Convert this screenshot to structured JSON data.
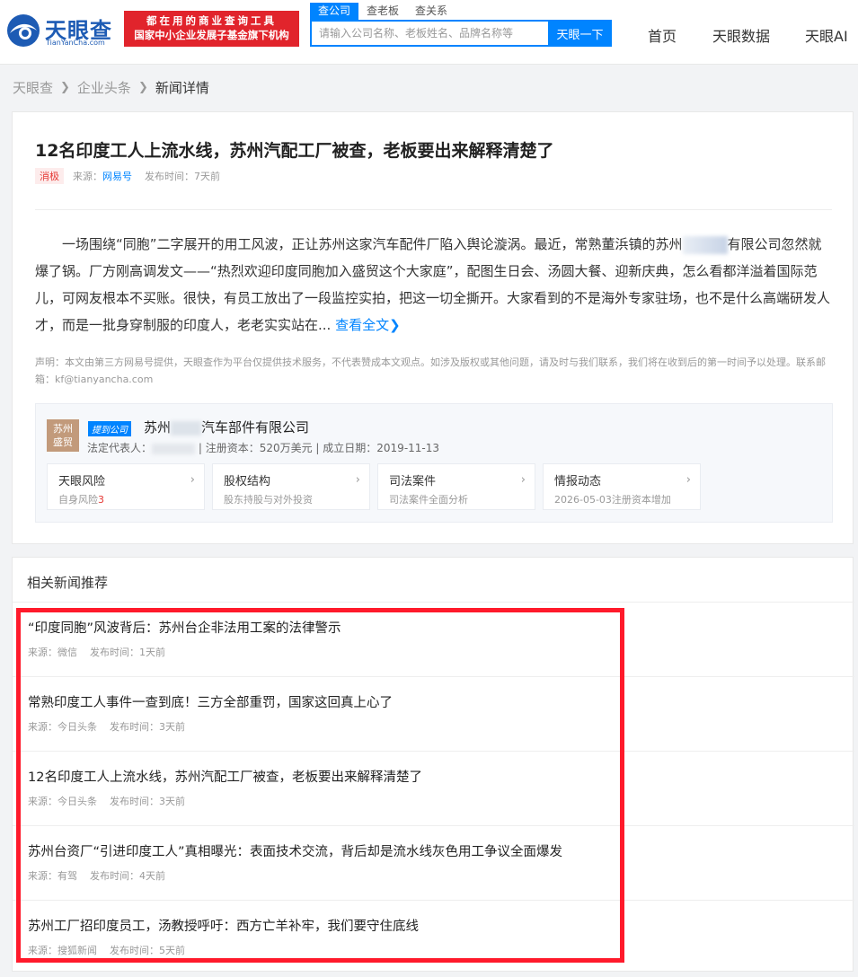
{
  "header": {
    "logo_text": "天眼查",
    "logo_sub": "TianYanCha.com",
    "slogan_line1": "都在用的商业查询工具",
    "slogan_line2": "国家中小企业发展子基金旗下机构",
    "search_tabs": [
      "查公司",
      "查老板",
      "查关系"
    ],
    "search_placeholder": "请输入公司名称、老板姓名、品牌名称等",
    "search_button": "天眼一下",
    "nav": [
      "首页",
      "天眼数据",
      "天眼AI"
    ]
  },
  "breadcrumb": [
    "天眼查",
    "企业头条",
    "新闻详情"
  ],
  "article": {
    "title": "12名印度工人上流水线，苏州汽配工厂被查，老板要出来解释清楚了",
    "tag": "消极",
    "source_label": "来源：",
    "source": "网易号",
    "time": "发布时间：7天前",
    "body_part1": "一场围绕“同胞”二字展开的用工风波，正让苏州这家汽车配件厂陷入舆论漩涡。最近，常熟董浜镇的苏州",
    "body_part2": "有限公司忽然就爆了锅。厂方刚高调发文——“热烈欢迎印度同胞加入盛贸这个大家庭”，配图生日会、汤圆大餐、迎新庆典，怎么看都洋溢着国际范儿，可网友根本不买账。很快，有员工放出了一段监控实拍，把这一切全撕开。大家看到的不是海外专家驻场，也不是什么高端研发人才，而是一批身穿制服的印度人，老老实实站在...",
    "read_more": "查看全文",
    "disclaimer": "声明：本文由第三方网易号提供，天眼查作为平台仅提供技术服务，不代表赞成本文观点。如涉及版权或其他问题，请及时与我们联系，我们将在收到后的第一时间予以处理。联系邮箱：kf@tianyancha.com"
  },
  "company": {
    "logo_text": "苏州盛贸",
    "badge": "提到公司",
    "name_prefix": "苏州",
    "name_suffix": "汽车部件有限公司",
    "legal_rep_label": "法定代表人：",
    "info_rest": "| 注册资本：520万美元 | 成立日期：2019-11-13",
    "cards": [
      {
        "title": "天眼风险",
        "sub": "自身风险",
        "num": "3"
      },
      {
        "title": "股权结构",
        "sub": "股东持股与对外投资",
        "num": ""
      },
      {
        "title": "司法案件",
        "sub": "司法案件全面分析",
        "num": ""
      },
      {
        "title": "情报动态",
        "sub": "2026-05-03注册资本增加",
        "num": ""
      }
    ]
  },
  "related": {
    "title": "相关新闻推荐",
    "items": [
      {
        "title": "“印度同胞”风波背后：苏州台企非法用工案的法律警示",
        "source": "来源：微信",
        "time": "发布时间：1天前"
      },
      {
        "title": "常熟印度工人事件一查到底！三方全部重罚，国家这回真上心了",
        "source": "来源：今日头条",
        "time": "发布时间：3天前"
      },
      {
        "title": "12名印度工人上流水线，苏州汽配工厂被查，老板要出来解释清楚了",
        "source": "来源：今日头条",
        "time": "发布时间：3天前"
      },
      {
        "title": "苏州台资厂“引进印度工人”真相曝光：表面技术交流，背后却是流水线灰色用工争议全面爆发",
        "source": "来源：有驾",
        "time": "发布时间：4天前"
      },
      {
        "title": "苏州工厂招印度员工，汤教授呼吁：西方亡羊补牢，我们要守住底线",
        "source": "来源：搜狐新闻",
        "time": "发布时间：5天前"
      }
    ]
  },
  "colors": {
    "brand_blue": "#0084ff",
    "slogan_red": "#e1242c",
    "highlight_red": "#ff1a2b",
    "negative_red": "#e53935"
  }
}
